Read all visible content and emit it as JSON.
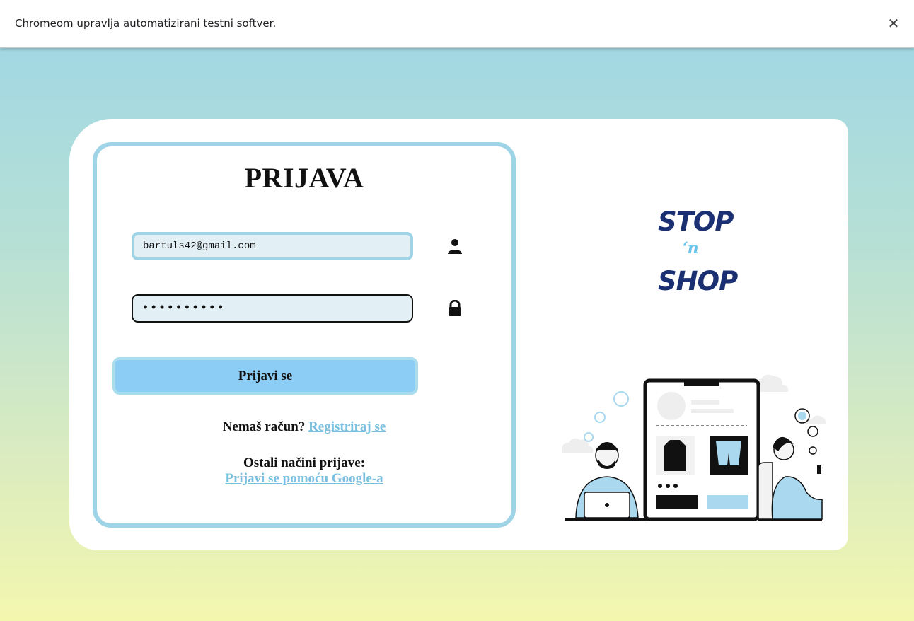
{
  "infobar": {
    "message": "Chromeom upravlja automatizirani testni softver.",
    "close_icon": "close-icon"
  },
  "login": {
    "title": "PRIJAVA",
    "email_value": "bartuls42@gmail.com",
    "password_value": "••••••••••",
    "submit_label": "Prijavi se",
    "no_account_text": "Nemaš račun?",
    "register_link": "Registriraj se",
    "other_methods_text": "Ostali načini prijave:",
    "google_link": "Prijavi se pomoću Google-a",
    "user_icon": "user-icon",
    "lock_icon": "lock-icon"
  },
  "brand": {
    "logo_line1": "STOP",
    "logo_line2": "‘n",
    "logo_line3": "SHOP"
  },
  "colors": {
    "accent_border": "#9fd3e6",
    "button_fill": "#8ccdf5",
    "link": "#7ac0e0",
    "logo_navy": "#1b2f73",
    "gradient_top": "#9dd6e6",
    "gradient_bottom": "#f3f7ae"
  }
}
